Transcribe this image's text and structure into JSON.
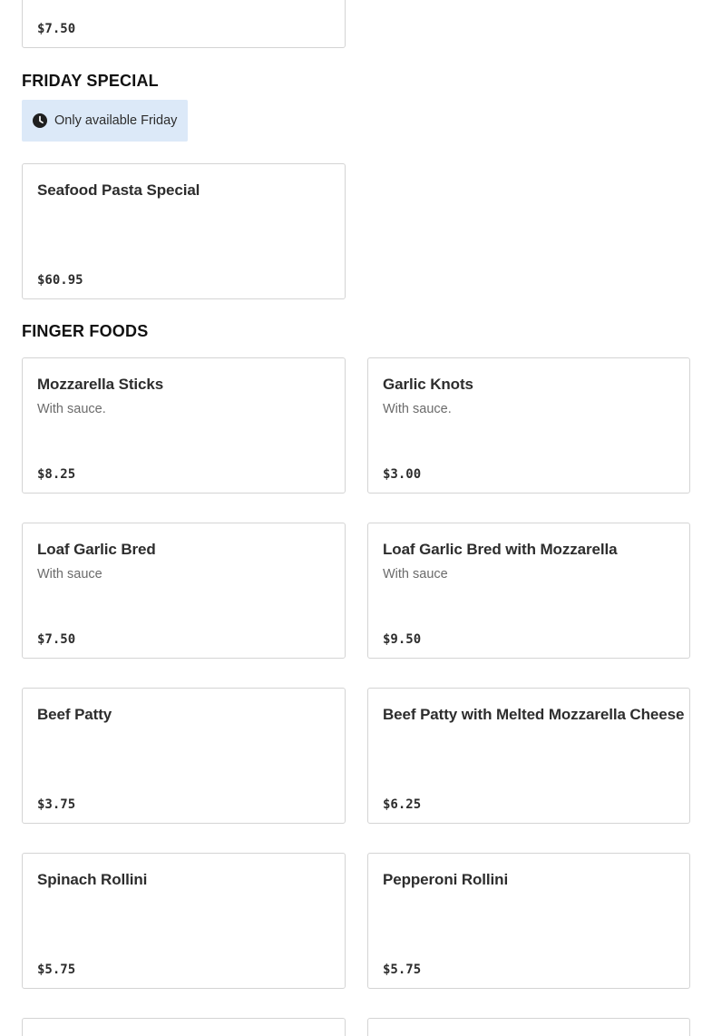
{
  "previous_section": {
    "items": [
      {
        "price": "$7.50"
      }
    ]
  },
  "friday_special": {
    "title": "FRIDAY SPECIAL",
    "availability": "Only available Friday",
    "items": [
      {
        "name": "Seafood Pasta Special",
        "price": "$60.95"
      }
    ]
  },
  "finger_foods": {
    "title": "FINGER FOODS",
    "items": [
      {
        "name": "Mozzarella Sticks",
        "description": "With sauce.",
        "price": "$8.25"
      },
      {
        "name": "Garlic Knots",
        "description": "With sauce.",
        "price": "$3.00"
      },
      {
        "name": "Loaf Garlic Bred",
        "description": "With sauce",
        "price": "$7.50"
      },
      {
        "name": "Loaf Garlic Bred with Mozzarella",
        "description": "With sauce",
        "price": "$9.50"
      },
      {
        "name": "Beef Patty",
        "price": "$3.75"
      },
      {
        "name": "Beef Patty with Melted Mozzarella Cheese",
        "price": "$6.25"
      },
      {
        "name": "Spinach Rollini",
        "price": "$5.75"
      },
      {
        "name": "Pepperoni Rollini",
        "price": "$5.75"
      }
    ]
  }
}
